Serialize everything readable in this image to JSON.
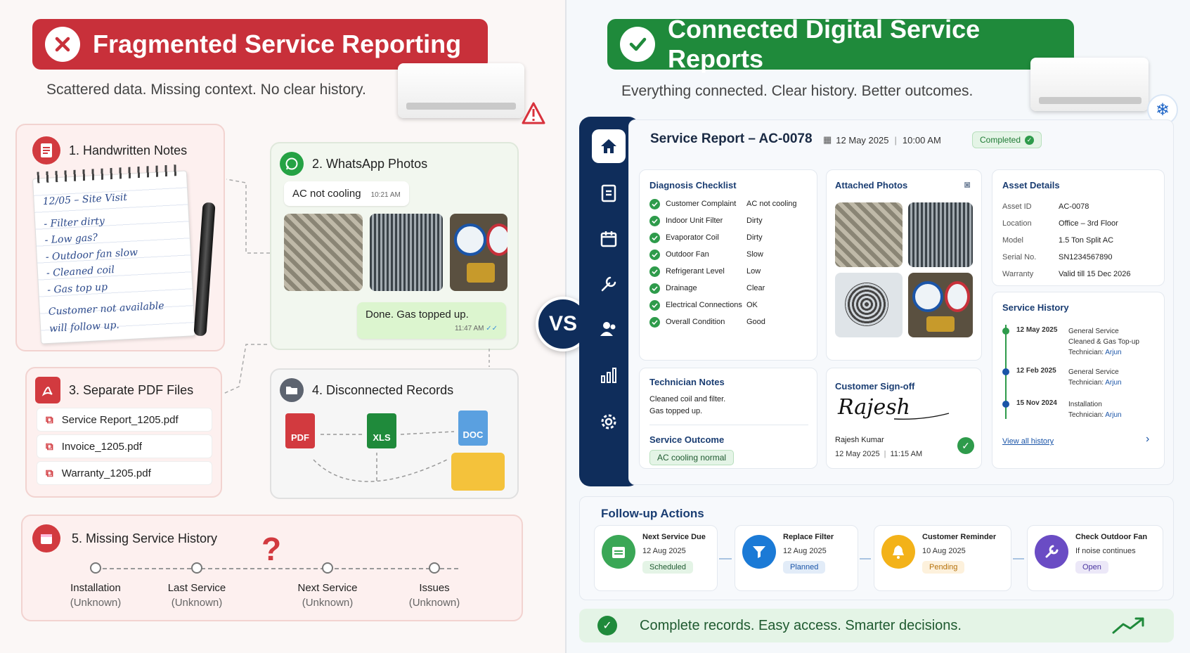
{
  "left": {
    "title": "Fragmented Service Reporting",
    "subtitle": "Scattered data. Missing context. No clear history.",
    "notes": {
      "title": "1. Handwritten Notes",
      "lines": [
        "12/05 – Site Visit",
        "- Filter dirty",
        "- Low gas?",
        "- Outdoor fan slow",
        "- Cleaned coil",
        "- Gas top up",
        "Customer not available",
        "will follow up."
      ]
    },
    "whatsapp": {
      "title": "2. WhatsApp Photos",
      "msg1": "AC not cooling",
      "time1": "10:21 AM",
      "msg2": "Done. Gas topped up.",
      "time2": "11:47 AM"
    },
    "pdfs": {
      "title": "3. Separate PDF Files",
      "files": [
        "Service Report_1205.pdf",
        "Invoice_1205.pdf",
        "Warranty_1205.pdf"
      ]
    },
    "records": {
      "title": "4. Disconnected Records",
      "pdf": "PDF",
      "xls": "XLS",
      "doc": "DOC"
    },
    "history": {
      "title": "5. Missing Service History",
      "mark": "?",
      "items": [
        {
          "label": "Installation",
          "status": "(Unknown)"
        },
        {
          "label": "Last Service",
          "status": "(Unknown)"
        },
        {
          "label": "Next Service",
          "status": "(Unknown)"
        },
        {
          "label": "Issues",
          "status": "(Unknown)"
        }
      ]
    }
  },
  "vs": "VS",
  "right": {
    "title": "Connected Digital Service Reports",
    "subtitle": "Everything connected. Clear history. Better outcomes.",
    "report": {
      "title": "Service Report – AC-0078",
      "date": "12 May 2025",
      "time": "10:00 AM",
      "status": "Completed"
    },
    "checklist": {
      "title": "Diagnosis Checklist",
      "rows": [
        {
          "k": "Customer Complaint",
          "v": "AC not cooling"
        },
        {
          "k": "Indoor Unit Filter",
          "v": "Dirty"
        },
        {
          "k": "Evaporator Coil",
          "v": "Dirty"
        },
        {
          "k": "Outdoor Fan",
          "v": "Slow"
        },
        {
          "k": "Refrigerant Level",
          "v": "Low"
        },
        {
          "k": "Drainage",
          "v": "Clear"
        },
        {
          "k": "Electrical Connections",
          "v": "OK"
        },
        {
          "k": "Overall Condition",
          "v": "Good"
        }
      ]
    },
    "photos": {
      "title": "Attached Photos"
    },
    "asset": {
      "title": "Asset Details",
      "rows": [
        {
          "k": "Asset ID",
          "v": "AC-0078"
        },
        {
          "k": "Location",
          "v": "Office – 3rd Floor"
        },
        {
          "k": "Model",
          "v": "1.5 Ton Split AC"
        },
        {
          "k": "Serial No.",
          "v": "SN1234567890"
        },
        {
          "k": "Warranty",
          "v": "Valid till 15 Dec 2026"
        }
      ]
    },
    "tech": {
      "title": "Technician Notes",
      "line1": "Cleaned coil and filter.",
      "line2": "Gas topped up.",
      "outcome_title": "Service Outcome",
      "outcome": "AC cooling normal"
    },
    "signoff": {
      "title": "Customer Sign-off",
      "signature": "Rajesh",
      "name": "Rajesh Kumar",
      "date": "12 May 2025",
      "time": "11:15 AM"
    },
    "history": {
      "title": "Service History",
      "entries": [
        {
          "date": "12 May 2025",
          "l1": "General Service",
          "l2": "Cleaned & Gas Top-up",
          "tech": "Arjun"
        },
        {
          "date": "12 Feb 2025",
          "l1": "General Service",
          "l2": "",
          "tech": "Arjun"
        },
        {
          "date": "15 Nov 2024",
          "l1": "Installation",
          "l2": "",
          "tech": "Arjun"
        }
      ],
      "tech_label": "Technician:",
      "link": "View all history"
    },
    "followup": {
      "title": "Follow-up Actions",
      "items": [
        {
          "title": "Next Service Due",
          "detail": "12 Aug 2025",
          "status": "Scheduled"
        },
        {
          "title": "Replace Filter",
          "detail": "12 Aug 2025",
          "status": "Planned"
        },
        {
          "title": "Customer Reminder",
          "detail": "10 Aug 2025",
          "status": "Pending"
        },
        {
          "title": "Check Outdoor Fan",
          "detail": "If noise continues",
          "status": "Open"
        }
      ]
    },
    "footer": "Complete records. Easy access. Smarter decisions."
  },
  "colors": {
    "red": "#c8303a",
    "green": "#1f8a3b",
    "navy": "#0f2d5b"
  }
}
